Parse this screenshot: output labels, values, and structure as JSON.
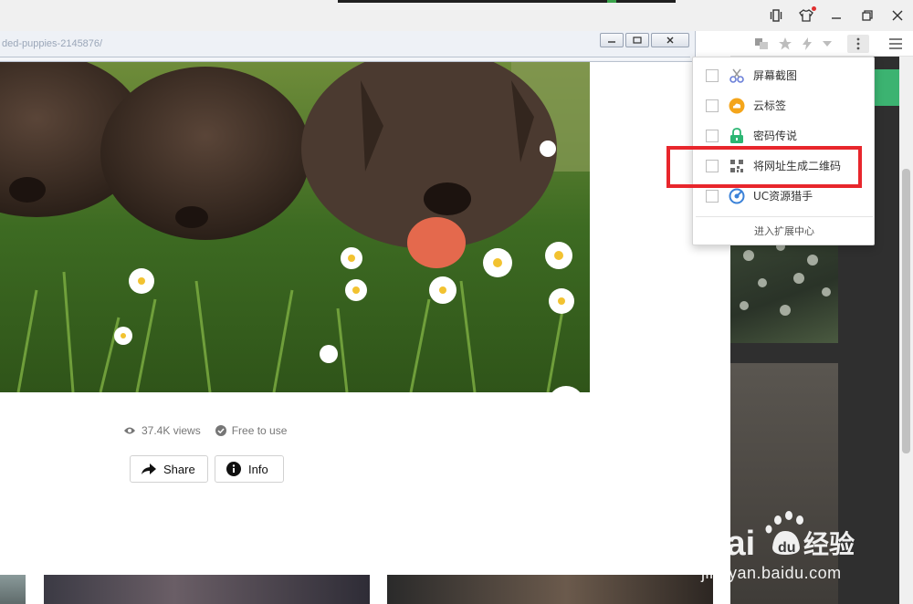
{
  "child_window": {
    "url_fragment": "ded-puppies-2145876/"
  },
  "photo": {
    "alt": "Three chocolate labrador puppies lying in grass with daisies"
  },
  "meta": {
    "views": "37.4K views",
    "license": "Free to use"
  },
  "actions": {
    "share": "Share",
    "info": "Info"
  },
  "extensions_menu": {
    "items": [
      {
        "label": "屏幕截图",
        "icon": "scissors-icon",
        "checked": false
      },
      {
        "label": "云标签",
        "icon": "cloud-tag-icon",
        "checked": false
      },
      {
        "label": "密码传说",
        "icon": "lock-icon",
        "checked": false
      },
      {
        "label": "将网址生成二维码",
        "icon": "qr-code-icon",
        "checked": false
      },
      {
        "label": "UC资源猎手",
        "icon": "uc-resource-icon",
        "checked": false
      }
    ],
    "footer": "进入扩展中心"
  },
  "watermark": {
    "url": "jingyan.baidu.com"
  },
  "colors": {
    "highlight": "#e8262c",
    "accent_green": "#3cb371"
  }
}
